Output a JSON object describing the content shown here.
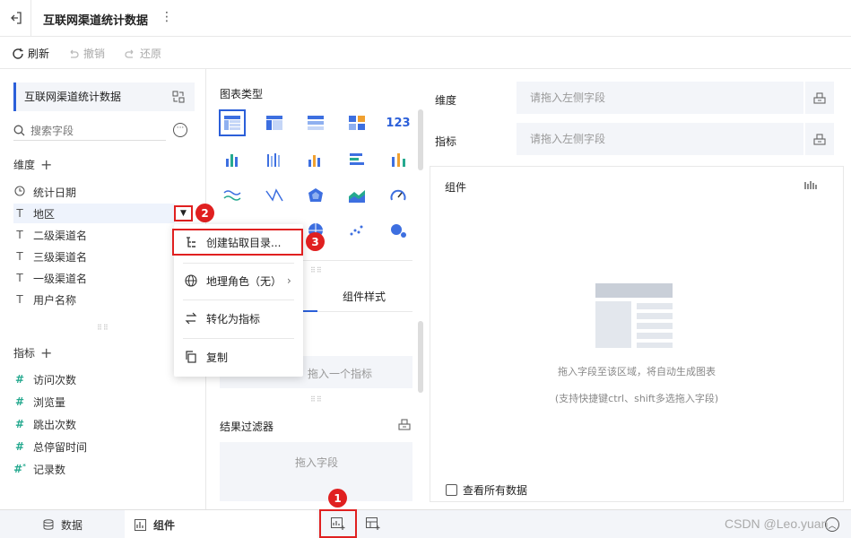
{
  "topbar": {
    "title": "互联网渠道统计数据"
  },
  "toolbar": {
    "refresh": "刷新",
    "undo": "撤销",
    "redo": "还原"
  },
  "left": {
    "dataset": "互联网渠道统计数据",
    "search_placeholder": "搜索字段",
    "dim_title": "维度",
    "dimensions": [
      "统计日期",
      "地区",
      "二级渠道名",
      "三级渠道名",
      "一级渠道名",
      "用户名称"
    ],
    "measure_title": "指标",
    "measures": [
      "访问次数",
      "浏览量",
      "跳出次数",
      "总停留时间",
      "记录数"
    ]
  },
  "context_menu": {
    "items": [
      "创建钻取目录...",
      "地理角色（无）",
      "转化为指标",
      "复制"
    ]
  },
  "badges": [
    "1",
    "2",
    "3"
  ],
  "middle": {
    "chart_type_title": "图表类型",
    "tab_style": "组件样式",
    "measure_hint": "拖入一个指标",
    "result_filter": "结果过滤器",
    "drag_field": "拖入字段"
  },
  "right": {
    "dim_label": "维度",
    "dim_placeholder": "请拖入左侧字段",
    "measure_label": "指标",
    "measure_placeholder": "请拖入左侧字段",
    "component_title": "组件",
    "hint1": "拖入字段至该区域，将自动生成图表",
    "hint2": "(支持快捷键ctrl、shift多选拖入字段)",
    "view_all": "查看所有数据"
  },
  "bottom": {
    "tab_data": "数据",
    "tab_component": "组件"
  },
  "watermark": "CSDN @Leo.yuan",
  "colors": {
    "accent": "#2b5fd9",
    "highlight": "#e02020",
    "field_green": "#25a98f"
  }
}
